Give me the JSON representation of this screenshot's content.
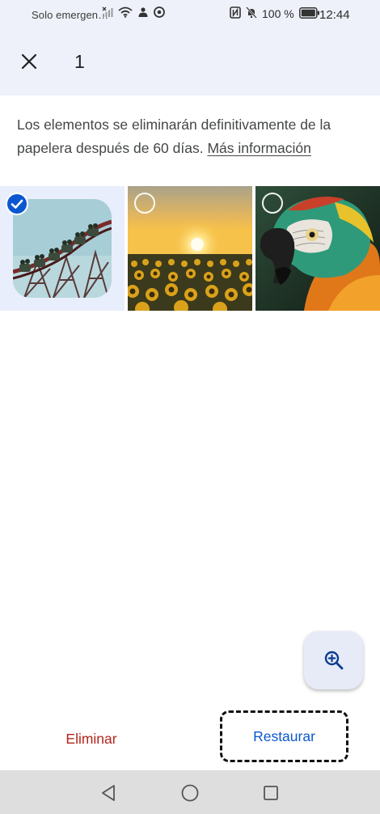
{
  "status_bar": {
    "carrier": "Solo emergen…",
    "battery": "100 %",
    "time": "12:44",
    "icons": [
      "no-signal-icon",
      "wifi-icon",
      "profile-icon",
      "chrome-icon",
      "nfc-icon",
      "mute-icon",
      "battery-icon"
    ]
  },
  "app_bar": {
    "close_icon": "close-icon",
    "selected_count": "1"
  },
  "info": {
    "text": "Los elementos se eliminarán definitivamente de la papelera después de 60 días.",
    "link": "Más información"
  },
  "grid": {
    "items": [
      {
        "subject": "roller coaster",
        "selected": true
      },
      {
        "subject": "sunflower field at sunset",
        "selected": false
      },
      {
        "subject": "macaw parrot",
        "selected": false
      }
    ]
  },
  "fab": {
    "icon": "zoom-in-icon"
  },
  "actions": {
    "delete_label": "Eliminar",
    "restore_label": "Restaurar"
  },
  "nav_bar": {
    "icons": [
      "back-icon",
      "home-icon",
      "recents-icon"
    ]
  },
  "colors": {
    "header_bg": "#eef1fa",
    "accent_blue": "#0b57d0",
    "delete_red": "#b3261e",
    "selected_tile_bg": "#e8eefb",
    "nav_bar_bg": "#dedede"
  }
}
